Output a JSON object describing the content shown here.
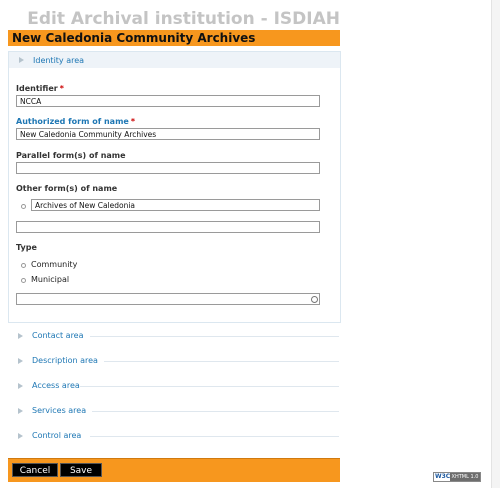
{
  "page": {
    "heading": "Edit Archival institution - ISDIAH"
  },
  "institution": {
    "name": "New Caledonia Community Archives"
  },
  "identity_area": {
    "title": "Identity area",
    "identifier": {
      "label": "Identifier",
      "required_mark": "*",
      "value": "NCCA"
    },
    "authorized_name": {
      "label": "Authorized form of name",
      "required_mark": "*",
      "value": "New Caledonia Community Archives"
    },
    "parallel_names": {
      "label": "Parallel form(s) of name",
      "value": ""
    },
    "other_names": {
      "label": "Other form(s) of name",
      "values": [
        "Archives of New Caledonia"
      ],
      "new_value": ""
    },
    "type": {
      "label": "Type",
      "options": [
        "Community",
        "Municipal"
      ],
      "input_value": ""
    }
  },
  "collapsed_areas": [
    "Contact area",
    "Description area",
    "Access area",
    "Services area",
    "Control area"
  ],
  "actions": {
    "cancel": "Cancel",
    "save": "Save"
  },
  "footer_badge": {
    "w3c": "W3C",
    "xhtml": "XHTML 1.0"
  }
}
